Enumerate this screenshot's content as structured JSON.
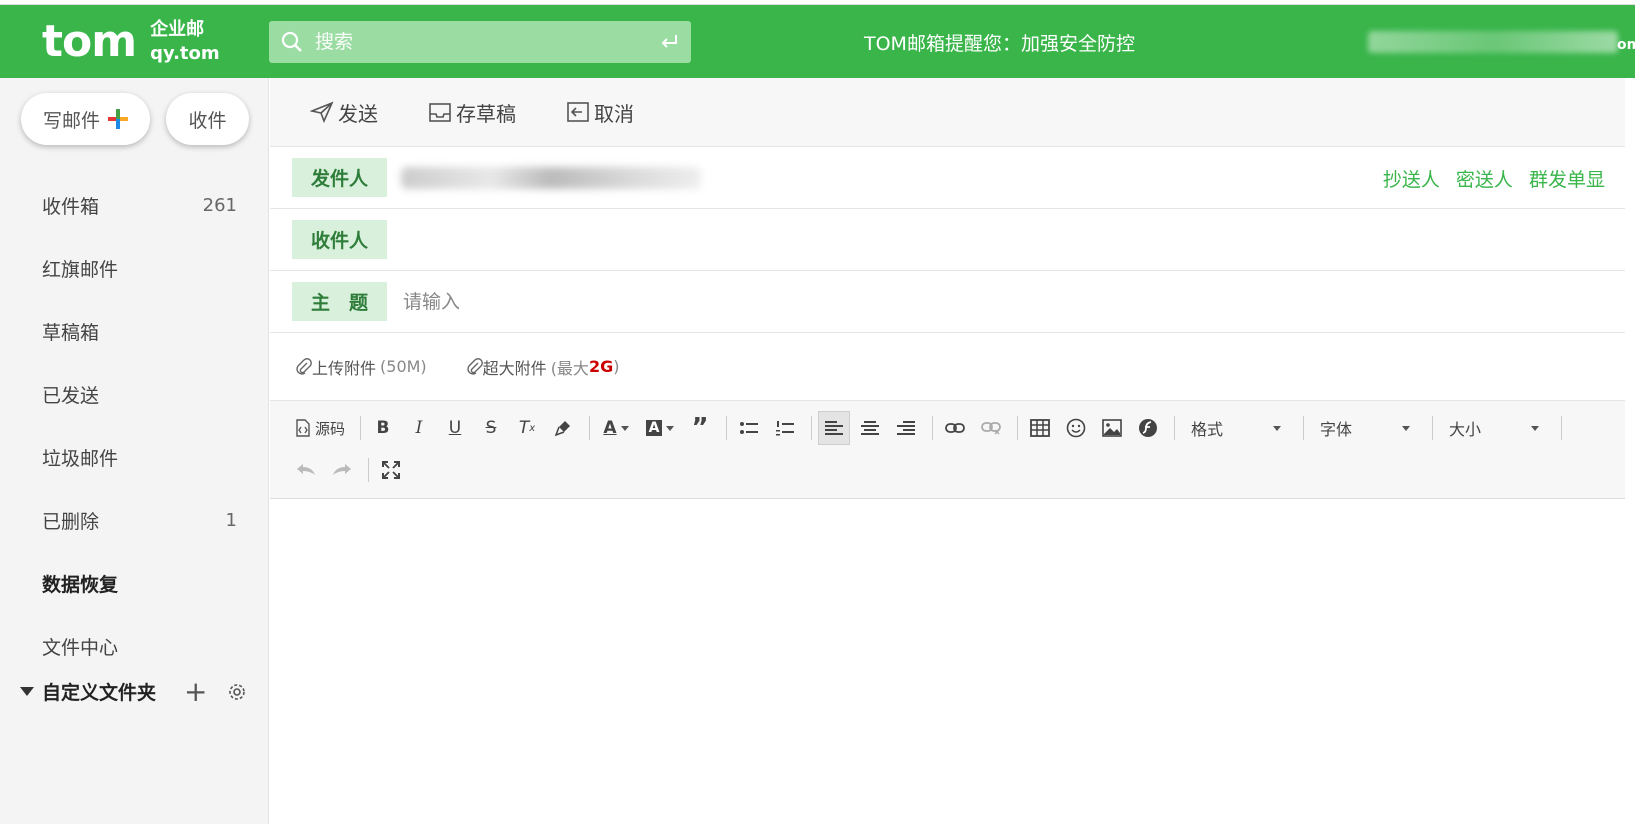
{
  "header": {
    "logo_main": "tom",
    "logo_sub1": "企业邮",
    "logo_sub2": "qy.tom",
    "search_placeholder": "搜索",
    "notice": "TOM邮箱提醒您：加强安全防控",
    "user_tail": "om"
  },
  "sidebar": {
    "compose_label": "写邮件",
    "receive_label": "收件",
    "folders": [
      {
        "label": "收件箱",
        "count": "261"
      },
      {
        "label": "红旗邮件",
        "count": ""
      },
      {
        "label": "草稿箱",
        "count": ""
      },
      {
        "label": "已发送",
        "count": ""
      },
      {
        "label": "垃圾邮件",
        "count": ""
      },
      {
        "label": "已删除",
        "count": "1"
      },
      {
        "label": "数据恢复",
        "count": ""
      },
      {
        "label": "文件中心",
        "count": ""
      }
    ],
    "custom_folder_label": "自定义文件夹"
  },
  "toolbar": {
    "send_label": "发送",
    "draft_label": "存草稿",
    "cancel_label": "取消"
  },
  "compose": {
    "from_label": "发件人",
    "to_label": "收件人",
    "subject_label": "主　题",
    "subject_placeholder": "请输入",
    "cc_link": "抄送人",
    "bcc_link": "密送人",
    "single_link": "群发单显"
  },
  "attachments": {
    "upload_label": "上传附件",
    "upload_limit": "(50M)",
    "large_label": "超大附件",
    "large_limit_prefix": "(最大 ",
    "large_limit_value": "2G",
    "large_limit_suffix": ")"
  },
  "editor": {
    "source_label": "源码",
    "format_label": "格式",
    "font_label": "字体",
    "size_label": "大小"
  },
  "colors": {
    "brand_green": "#39b54a",
    "tag_bg": "#d9f0dc"
  }
}
